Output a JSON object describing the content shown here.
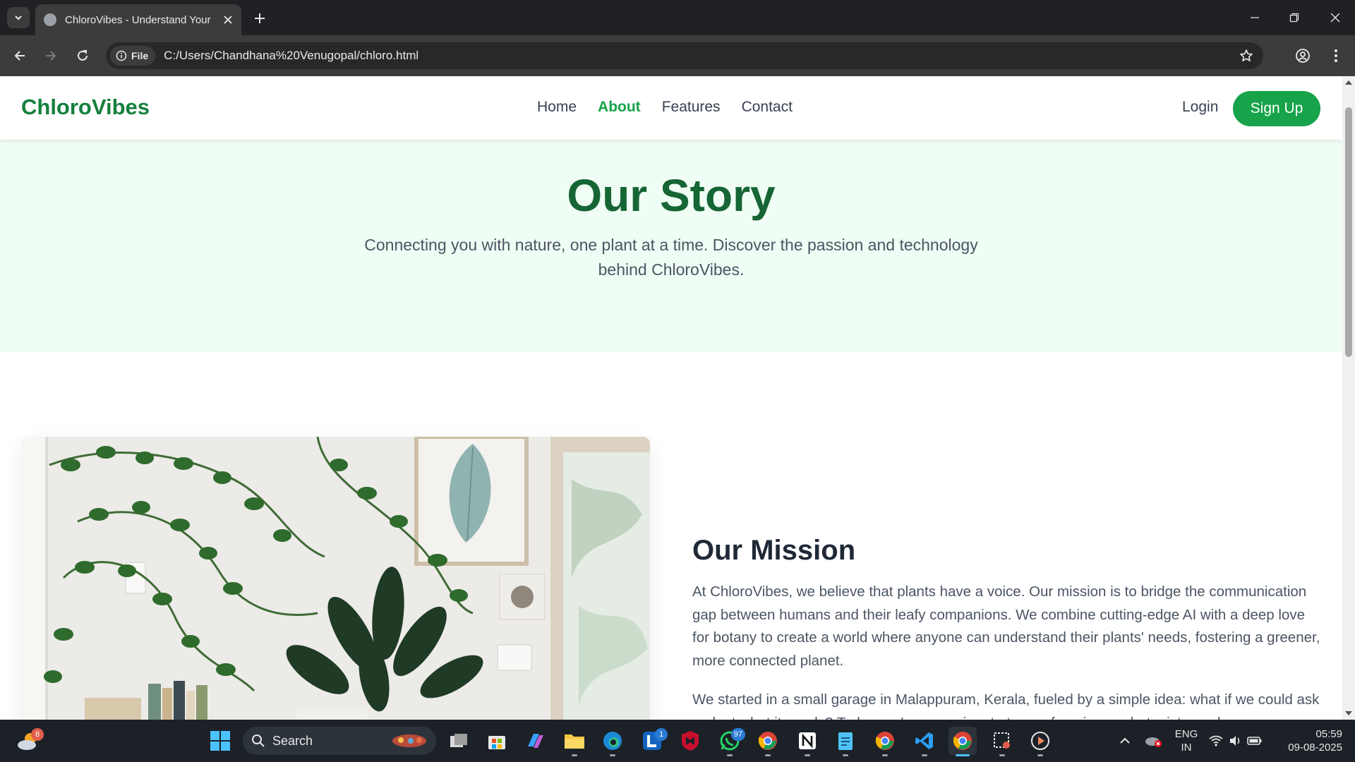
{
  "browser": {
    "tab_title": "ChloroVibes - Understand Your",
    "scheme_chip": "File",
    "address": "C:/Users/Chandhana%20Venugopal/chloro.html"
  },
  "site": {
    "brand": "ChloroVibes",
    "nav": [
      {
        "label": "Home",
        "active": false
      },
      {
        "label": "About",
        "active": true
      },
      {
        "label": "Features",
        "active": false
      },
      {
        "label": "Contact",
        "active": false
      }
    ],
    "login": "Login",
    "signup": "Sign Up",
    "colors": {
      "brand_green": "#16a34a",
      "hero_bg": "#effdf4",
      "heading_green": "#166534"
    }
  },
  "hero": {
    "title": "Our Story",
    "subtitle": "Connecting you with nature, one plant at a time. Discover the passion and technology behind ChloroVibes."
  },
  "mission": {
    "title": "Our Mission",
    "paragraph1": "At ChloroVibes, we believe that plants have a voice. Our mission is to bridge the communication gap between humans and their leafy companions. We combine cutting-edge AI with a deep love for botany to create a world where anyone can understand their plants' needs, fostering a greener, more connected planet.",
    "paragraph2": "We started in a small garage in Malappuram, Kerala, fueled by a simple idea: what if we could ask a plant what it needs? Today, we're a passionate team of engineers, botanists, and"
  },
  "taskbar": {
    "weather_badge": "8",
    "search_label": "Search",
    "badges": {
      "lens": "1",
      "whatsapp": "97"
    },
    "language": "ENG",
    "region": "IN",
    "time": "05:59",
    "date": "09-08-2025"
  }
}
